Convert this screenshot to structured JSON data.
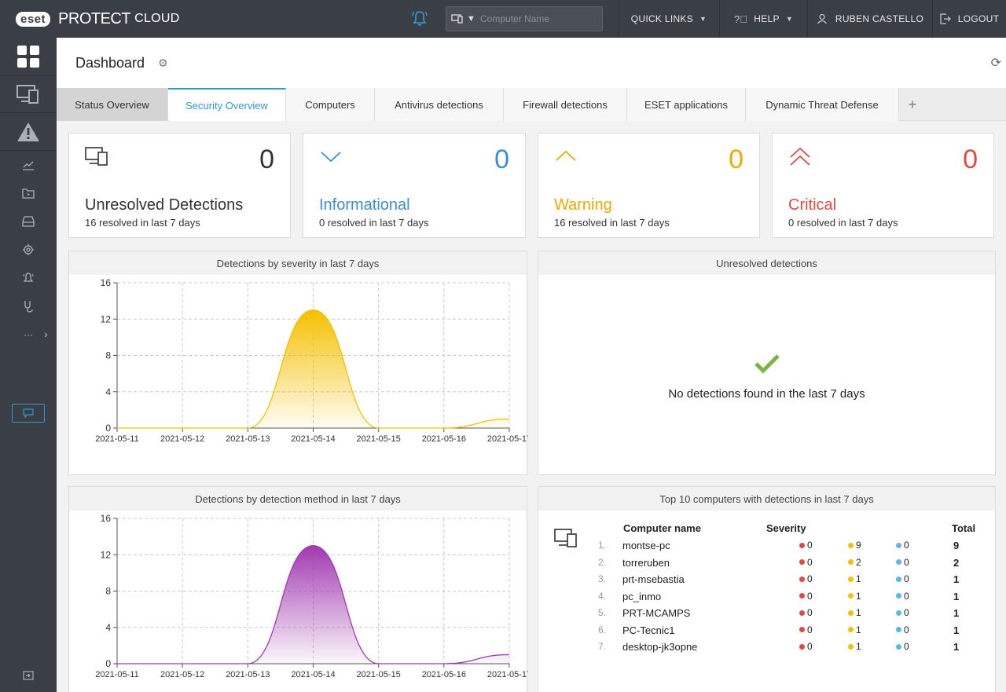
{
  "colors": {
    "accent": "#2f9ad2",
    "informational": "#3a8dd8",
    "warning": "#f0a800",
    "critical": "#e04a3f",
    "severity_chart": "#f5c000",
    "method_chart": "#a13ab0",
    "success": "#7ab541"
  },
  "topbar": {
    "brand": {
      "logo": "eset",
      "product": "PROTECT",
      "edition": "CLOUD"
    },
    "notification_icon": "bell-icon",
    "search": {
      "type_icon": "computer-icon",
      "placeholder": "Computer Name",
      "value": ""
    },
    "quick_links": "QUICK LINKS",
    "help": "HELP",
    "user": "RUBEN CASTELLO",
    "logout": "LOGOUT"
  },
  "sidebar": {
    "items": [
      {
        "name": "dashboard",
        "icon": "dashboard-icon"
      },
      {
        "name": "computers",
        "icon": "computers-icon"
      },
      {
        "name": "detections",
        "icon": "warning-icon"
      },
      {
        "name": "reports",
        "icon": "chart-icon"
      },
      {
        "name": "tasks",
        "icon": "tasks-icon"
      },
      {
        "name": "installers",
        "icon": "installer-icon"
      },
      {
        "name": "policies",
        "icon": "policies-icon"
      },
      {
        "name": "notifications",
        "icon": "notifications-icon"
      },
      {
        "name": "status-overview",
        "icon": "status-icon"
      },
      {
        "name": "more",
        "label": "···"
      }
    ]
  },
  "header": {
    "title": "Dashboard"
  },
  "tabs": [
    {
      "label": "Status Overview"
    },
    {
      "label": "Security Overview"
    },
    {
      "label": "Computers"
    },
    {
      "label": "Antivirus detections"
    },
    {
      "label": "Firewall detections"
    },
    {
      "label": "ESET applications"
    },
    {
      "label": "Dynamic Threat Defense"
    },
    {
      "label": "+"
    }
  ],
  "kpis": [
    {
      "label": "Unresolved Detections",
      "value": "0",
      "sub": "16 resolved in last 7 days",
      "icon": "computer-icon"
    },
    {
      "label": "Informational",
      "value": "0",
      "sub": "0 resolved in last 7 days",
      "icon": "chevron-down-icon"
    },
    {
      "label": "Warning",
      "value": "0",
      "sub": "16 resolved in last 7 days",
      "icon": "chevron-up-icon"
    },
    {
      "label": "Critical",
      "value": "0",
      "sub": "0 resolved in last 7 days",
      "icon": "double-chevron-up-icon"
    }
  ],
  "panels": {
    "severity_title": "Detections by severity in last 7 days",
    "unresolved_title": "Unresolved detections",
    "unresolved_msg": "No detections found in the last 7 days",
    "method_title": "Detections by detection method in last 7 days",
    "top10_title": "Top 10 computers with detections in last 7 days"
  },
  "chart_data": [
    {
      "type": "area",
      "title": "Detections by severity in last 7 days",
      "x": [
        "2021-05-11",
        "2021-05-12",
        "2021-05-13",
        "2021-05-14",
        "2021-05-15",
        "2021-05-16",
        "2021-05-17"
      ],
      "y_ticks": [
        0,
        4,
        8,
        12,
        16
      ],
      "ylim": [
        0,
        16
      ],
      "grid": true,
      "series": [
        {
          "values": [
            0,
            0,
            0,
            13,
            0,
            0,
            1
          ]
        }
      ]
    },
    {
      "type": "area",
      "title": "Detections by detection method in last 7 days",
      "x": [
        "2021-05-11",
        "2021-05-12",
        "2021-05-13",
        "2021-05-14",
        "2021-05-15",
        "2021-05-16",
        "2021-05-17"
      ],
      "y_ticks": [
        0,
        4,
        8,
        12,
        16
      ],
      "ylim": [
        0,
        16
      ],
      "grid": true,
      "series": [
        {
          "values": [
            0,
            0,
            0,
            13,
            0,
            0,
            1
          ]
        }
      ]
    }
  ],
  "top10": {
    "headers": {
      "name": "Computer name",
      "severity": "Severity",
      "total": "Total"
    },
    "rows": [
      {
        "n": "1.",
        "name": "montse-pc",
        "critical": "0",
        "warning": "9",
        "info": "0",
        "total": "9"
      },
      {
        "n": "2.",
        "name": "torreruben",
        "critical": "0",
        "warning": "2",
        "info": "0",
        "total": "2"
      },
      {
        "n": "3.",
        "name": "prt-msebastia",
        "critical": "0",
        "warning": "1",
        "info": "0",
        "total": "1"
      },
      {
        "n": "4.",
        "name": "pc_inmo",
        "critical": "0",
        "warning": "1",
        "info": "0",
        "total": "1"
      },
      {
        "n": "5.",
        "name": "PRT-MCAMPS",
        "critical": "0",
        "warning": "1",
        "info": "0",
        "total": "1"
      },
      {
        "n": "6.",
        "name": "PC-Tecnic1",
        "critical": "0",
        "warning": "1",
        "info": "0",
        "total": "1"
      },
      {
        "n": "7.",
        "name": "desktop-jk3opne",
        "critical": "0",
        "warning": "1",
        "info": "0",
        "total": "1"
      }
    ]
  }
}
